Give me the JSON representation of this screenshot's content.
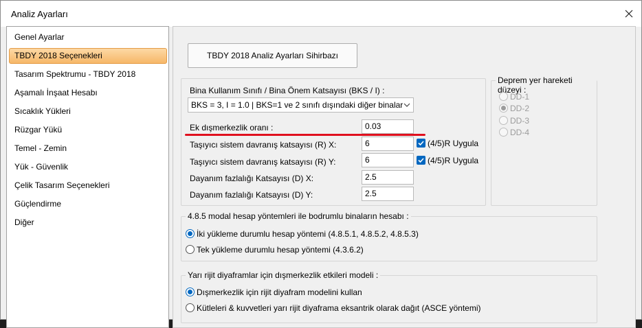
{
  "window": {
    "title": "Analiz Ayarları"
  },
  "sidebar": {
    "items": [
      {
        "label": "Genel Ayarlar"
      },
      {
        "label": "TBDY 2018 Seçenekleri"
      },
      {
        "label": "Tasarım Spektrumu - TBDY 2018"
      },
      {
        "label": "Aşamalı İnşaat Hesabı"
      },
      {
        "label": "Sıcaklık Yükleri"
      },
      {
        "label": "Rüzgar Yükü"
      },
      {
        "label": "Temel - Zemin"
      },
      {
        "label": "Yük - Güvenlik"
      },
      {
        "label": "Çelik Tasarım Seçenekleri"
      },
      {
        "label": "Güçlendirme"
      },
      {
        "label": "Diğer"
      }
    ],
    "selected": "TBDY 2018 Seçenekleri"
  },
  "wizard_button": {
    "label": "TBDY 2018 Analiz Ayarları Sihirbazı"
  },
  "params": {
    "bks_label": "Bina Kullanım Sınıfı / Bina Önem Katsayısı (BKS / I) :",
    "bks_value": "BKS = 3, I = 1.0 | BKS=1 ve 2 sınıfı dışındaki diğer binalar",
    "ecc_label": "Ek dışmerkezlik oranı :",
    "ecc_value": "0.03",
    "rx_label": "Taşıyıcı sistem davranış katsayısı (R) X:",
    "rx_value": "6",
    "ry_label": "Taşıyıcı sistem davranış katsayısı (R) Y:",
    "ry_value": "6",
    "r_check_label": "(4/5)R Uygula",
    "dx_label": "Dayanım fazlalığı Katsayısı (D) X:",
    "dx_value": "2.5",
    "dy_label": "Dayanım fazlalığı Katsayısı (D) Y:",
    "dy_value": "2.5"
  },
  "ground_motion": {
    "caption": "Deprem yer hareketi düzeyi :",
    "options": [
      "DD-1",
      "DD-2",
      "DD-3",
      "DD-4"
    ],
    "selected": "DD-2"
  },
  "modal_group": {
    "caption": "4.8.5 modal hesap yöntemleri ile bodrumlu binaların hesabı :",
    "options": [
      "İki yükleme durumlu hesap yöntemi (4.8.5.1, 4.8.5.2, 4.8.5.3)",
      "Tek yükleme durumlu hesap yöntemi (4.3.6.2)"
    ],
    "selected": 0
  },
  "diaphragm_group": {
    "caption": "Yarı rijit diyaframlar için dışmerkezlik etkileri modeli :",
    "options": [
      "Dışmerkezlik için rijit diyafram modelini kullan",
      "Kütleleri & kuvvetleri yarı rijit diyaframa eksantrik olarak dağıt (ASCE yöntemi)"
    ],
    "selected": 0
  },
  "colors": {
    "accent": "#0067c0",
    "selection": "#f6b768",
    "annotation": "#e0101e"
  },
  "icons": {
    "close": "close-icon",
    "combo": "chevron-down-icon",
    "check": "check-icon"
  }
}
